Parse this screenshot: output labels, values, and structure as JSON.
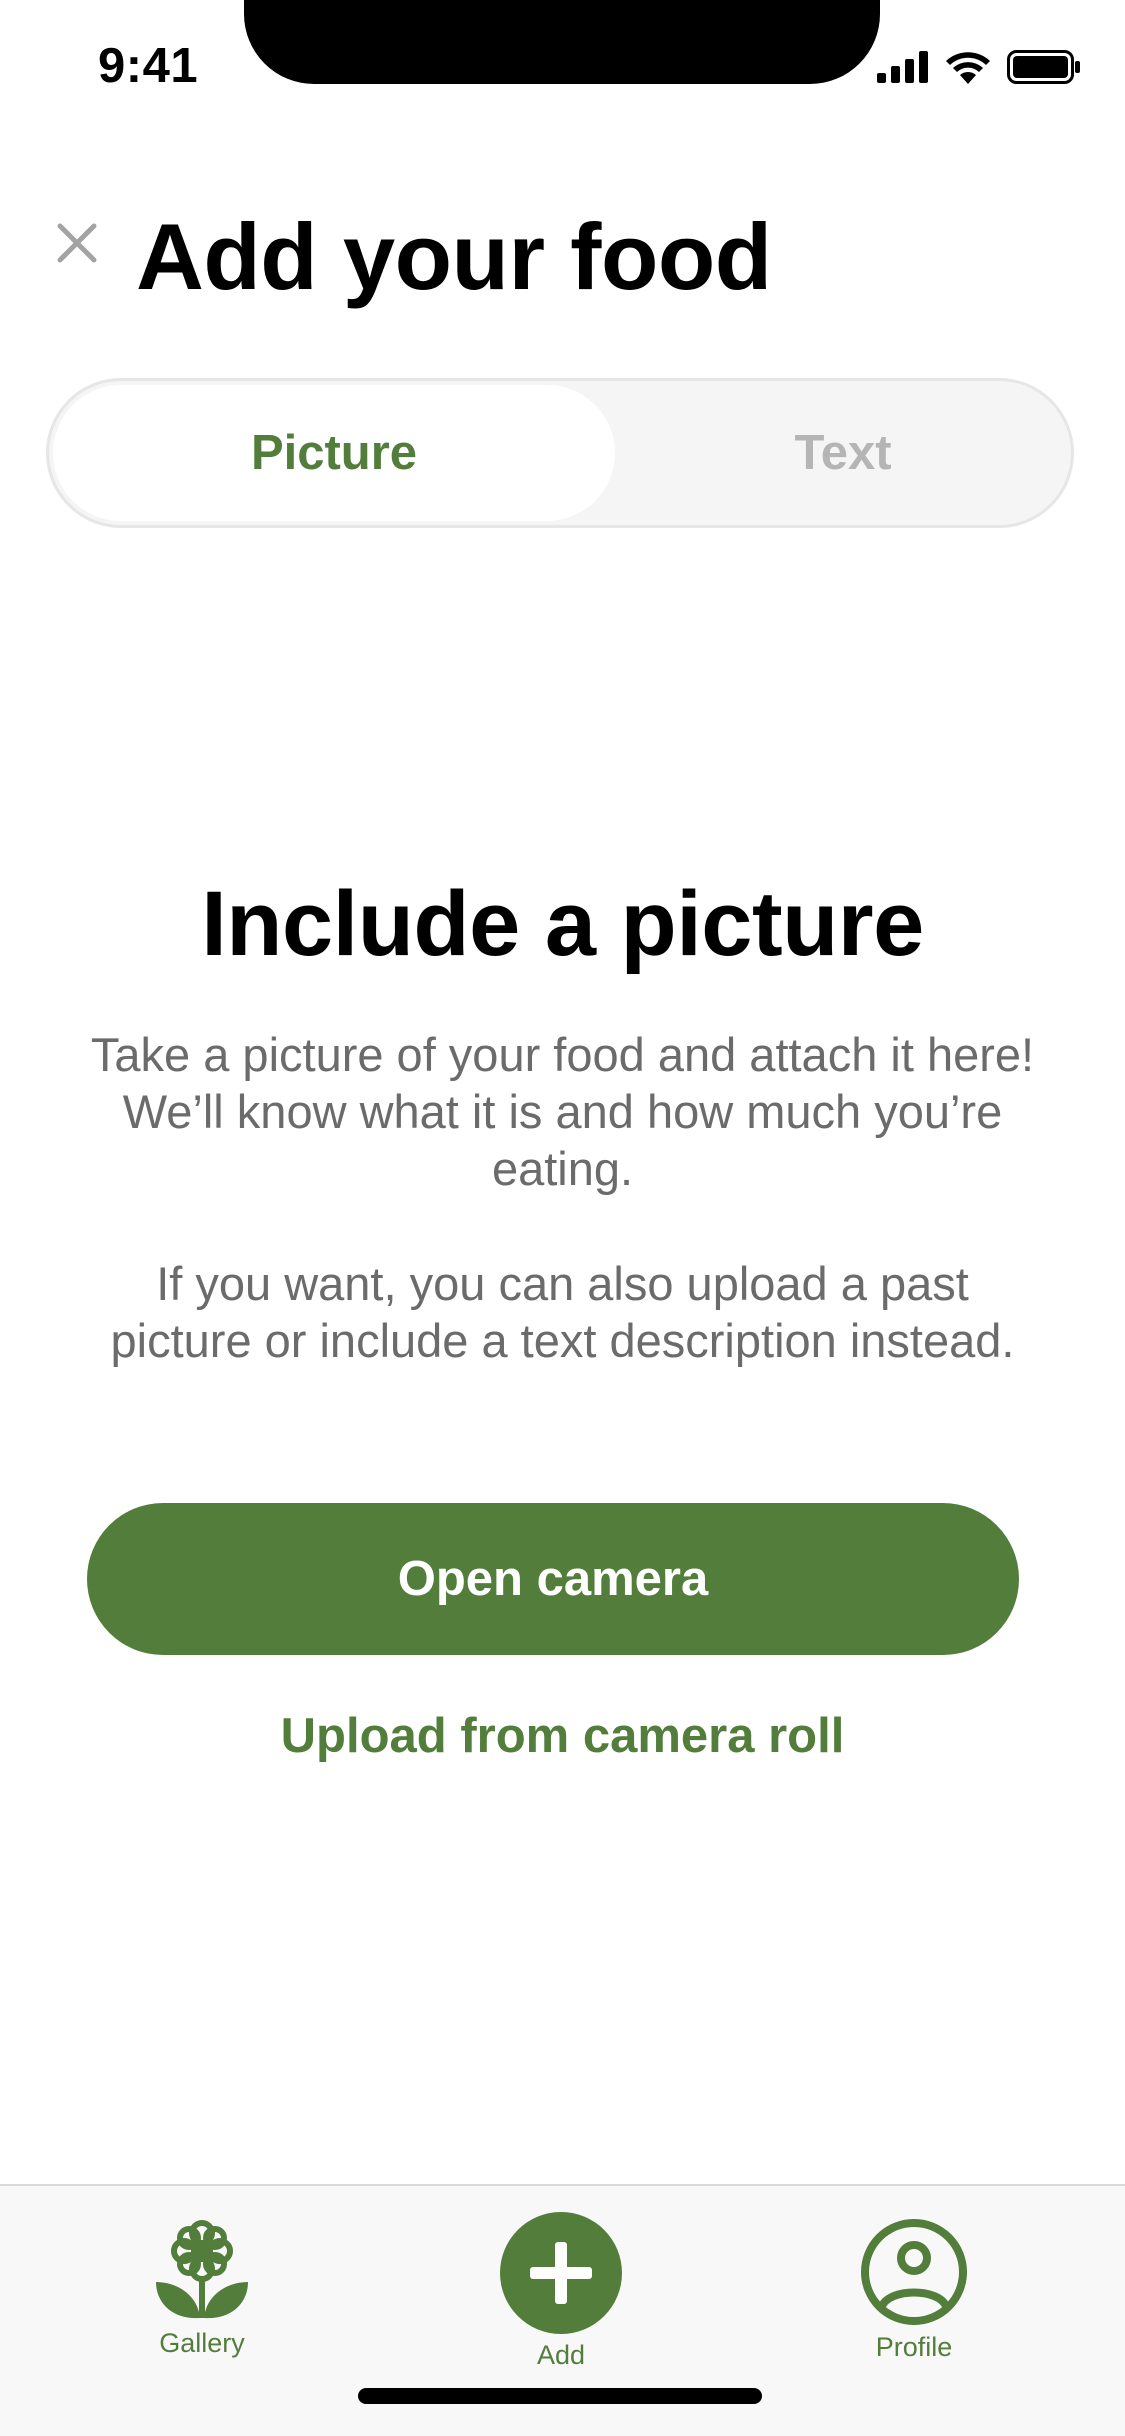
{
  "status_bar": {
    "time": "9:41"
  },
  "header": {
    "title": "Add your food",
    "close_icon": "close-icon"
  },
  "segmented": {
    "options": [
      "Picture",
      "Text"
    ],
    "selected": "Picture"
  },
  "main": {
    "title": "Include a picture",
    "paragraph1": "Take a picture of your food and attach it here! We’ll know what it is and how much you’re eating.",
    "paragraph2": "If you want, you can also upload a past picture or include a text description instead.",
    "primary_button": "Open camera",
    "secondary_link": "Upload from camera roll"
  },
  "tab_bar": {
    "items": [
      {
        "label": "Gallery",
        "icon": "flower-icon"
      },
      {
        "label": "Add",
        "icon": "plus-icon"
      },
      {
        "label": "Profile",
        "icon": "user-circle-icon"
      }
    ]
  },
  "colors": {
    "accent": "#527d3b",
    "muted_text": "#6b6b6b",
    "inactive_text": "#b5b5b5"
  }
}
